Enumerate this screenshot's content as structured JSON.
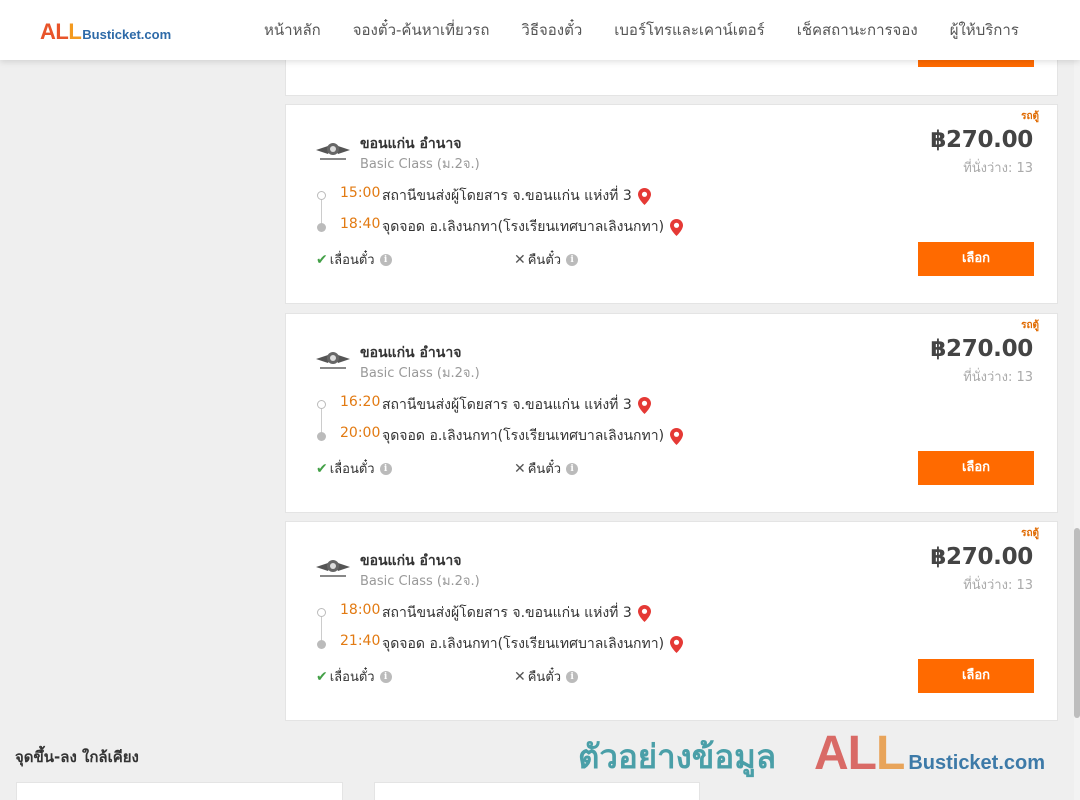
{
  "header": {
    "logo_all_1": "AL",
    "logo_all_2": "L",
    "logo_domain": "Busticket.com",
    "nav": [
      {
        "label": "หน้าหลัก"
      },
      {
        "label": "จองตั๋ว-ค้นหาเที่ยวรถ"
      },
      {
        "label": "วิธีจองตั๋ว"
      },
      {
        "label": "เบอร์โทรและเคาน์เตอร์"
      },
      {
        "label": "เช็คสถานะการจอง"
      },
      {
        "label": "ผู้ให้บริการ"
      }
    ]
  },
  "trips": [
    {
      "tag": "รถตู้",
      "route": "ขอนแก่น อำนาจ",
      "bus_class": "Basic Class (ม.2จ.)",
      "price": "฿270.00",
      "seats": "ที่นั่งว่าง: 13",
      "depart_time": "15:00",
      "depart_stop": "สถานีขนส่งผู้โดยสาร จ.ขอนแก่น แห่งที่ 3",
      "arrive_time": "18:40",
      "arrive_stop": "จุดจอด อ.เลิงนกทา(โรงเรียนเทศบาลเลิงนกทา)",
      "feature_ok": "เลื่อนตั๋ว",
      "feature_no": "คืนตั๋ว",
      "select_label": "เลือก"
    },
    {
      "tag": "รถตู้",
      "route": "ขอนแก่น อำนาจ",
      "bus_class": "Basic Class (ม.2จ.)",
      "price": "฿270.00",
      "seats": "ที่นั่งว่าง: 13",
      "depart_time": "16:20",
      "depart_stop": "สถานีขนส่งผู้โดยสาร จ.ขอนแก่น แห่งที่ 3",
      "arrive_time": "20:00",
      "arrive_stop": "จุดจอด อ.เลิงนกทา(โรงเรียนเทศบาลเลิงนกทา)",
      "feature_ok": "เลื่อนตั๋ว",
      "feature_no": "คืนตั๋ว",
      "select_label": "เลือก"
    },
    {
      "tag": "รถตู้",
      "route": "ขอนแก่น อำนาจ",
      "bus_class": "Basic Class (ม.2จ.)",
      "price": "฿270.00",
      "seats": "ที่นั่งว่าง: 13",
      "depart_time": "18:00",
      "depart_stop": "สถานีขนส่งผู้โดยสาร จ.ขอนแก่น แห่งที่ 3",
      "arrive_time": "21:40",
      "arrive_stop": "จุดจอด อ.เลิงนกทา(โรงเรียนเทศบาลเลิงนกทา)",
      "feature_ok": "เลื่อนตั๋ว",
      "feature_no": "คืนตั๋ว",
      "select_label": "เลือก"
    }
  ],
  "nearby": {
    "title": "จุดขึ้น-ลง ใกล้เคียง"
  },
  "watermark": {
    "text": "ตัวอย่างข้อมูล",
    "logo_all_1": "AL",
    "logo_all_2": "L",
    "logo_domain": "Busticket.com"
  },
  "colors": {
    "accent": "#ff6a00",
    "time": "#e27a12",
    "ok": "#43a047"
  }
}
